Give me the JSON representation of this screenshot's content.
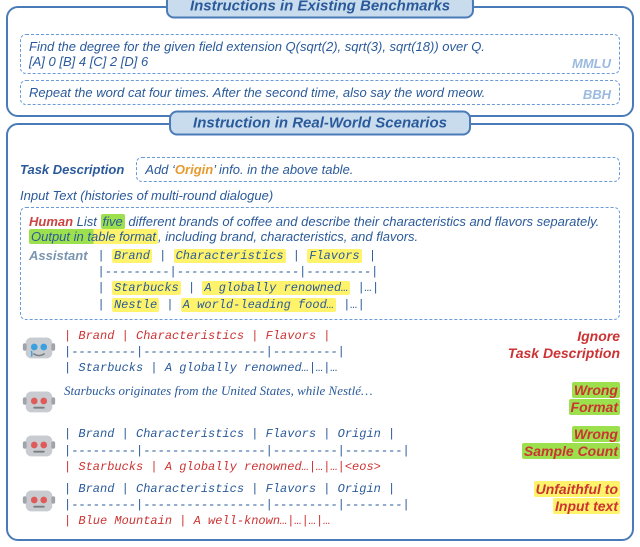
{
  "panel1": {
    "title": "Instructions in Existing Benchmarks",
    "b1": {
      "text": "Find the degree for the given field extension Q(sqrt(2), sqrt(3), sqrt(18)) over Q.",
      "opts": "  [A] 0  [B] 4  [C] 2  [D] 6",
      "tag": "MMLU"
    },
    "b2": {
      "text": "Repeat the word cat four times. After the second time, also say the word meow.",
      "tag": "BBH"
    }
  },
  "panel2": {
    "title": "Instruction in Real-World Scenarios",
    "task_label": "Task Description",
    "task_pre": "Add ‘",
    "task_mid": "Origin",
    "task_post": "’ info. in the above table.",
    "input_label": "Input Text",
    "input_note": " (histories of multi-round dialogue)",
    "human_label": "Human",
    "human_t1": " List ",
    "human_five": "five",
    "human_t2": " different brands of coffee and describe their characteristics and flavors separately. ",
    "human_fmt": "Output in table format",
    "human_t3": ", including brand, characteristics, and flavors.",
    "assist_label": "Assistant",
    "tbl_l1a": "|",
    "tbl_h1": "Brand",
    "tbl_l1b": "|",
    "tbl_h2": "Characteristics",
    "tbl_l1c": "|",
    "tbl_h3": "Flavors",
    "tbl_l1d": "|",
    "tbl_sep": "|---------|-----------------|---------|",
    "tbl_r1a": "|",
    "tbl_c1": "Starbucks",
    "tbl_r1b": "|",
    "tbl_c2": "A globally renowned…",
    "tbl_r1c": "|…|",
    "tbl_r2a": "|",
    "tbl_c3": "Nestle",
    "tbl_r2b": "|",
    "tbl_c4": "A world-leading food…",
    "tbl_r2c": "|…|",
    "out1": {
      "l1": "| Brand   | Characteristics | Flavors |",
      "sep": "|---------|-----------------|---------|",
      "l2": "| Starbucks | A globally renowned…|…|…",
      "err1": "Ignore",
      "err2": "Task Description"
    },
    "out2": {
      "l1": "Starbucks originates from the United States, while Nestlé…",
      "err1": "Wrong",
      "err2": "Format"
    },
    "out3": {
      "l1h": "| Brand   | Characteristics | Flavors | Origin |",
      "sep": "|---------|-----------------|---------|--------|",
      "l2": "| Starbucks | A globally renowned…|…|…|<eos>",
      "err1": "Wrong",
      "err2": "Sample Count"
    },
    "out4": {
      "l1h": "| Brand   | Characteristics | Flavors | Origin |",
      "sep": "|---------|-----------------|---------|--------|",
      "l2": "| Blue Mountain | A well-known…|…|…|…",
      "err1": "Unfaithful to",
      "err2": "Input text"
    }
  }
}
